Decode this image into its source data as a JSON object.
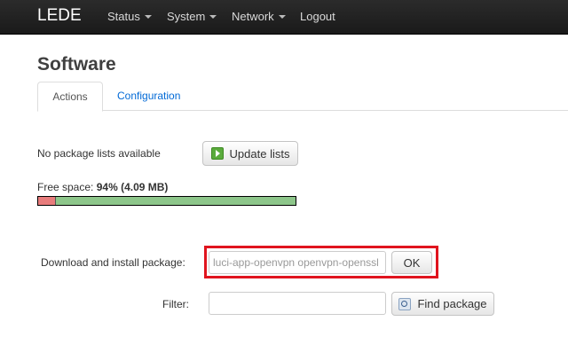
{
  "navbar": {
    "brand": "LEDE",
    "items": [
      {
        "label": "Status"
      },
      {
        "label": "System"
      },
      {
        "label": "Network"
      },
      {
        "label": "Logout"
      }
    ]
  },
  "page": {
    "title": "Software",
    "tabs": [
      {
        "label": "Actions",
        "active": true
      },
      {
        "label": "Configuration",
        "active": false
      }
    ]
  },
  "actions": {
    "no_lists_text": "No package lists available",
    "update_button": "Update lists",
    "free_space_label": "Free space:",
    "free_space_value": "94% (4.09 MB)",
    "free_space_percent": 94,
    "download_label": "Download and install package:",
    "download_value": "luci-app-openvpn openvpn-openssl",
    "ok_button": "OK",
    "filter_label": "Filter:",
    "filter_value": "",
    "find_button": "Find package"
  },
  "colors": {
    "navbar": "#1f1f1f",
    "link": "#0069d6",
    "bar_free": "#8dc68a",
    "bar_used": "#e87c7c",
    "highlight": "#e0141e"
  }
}
